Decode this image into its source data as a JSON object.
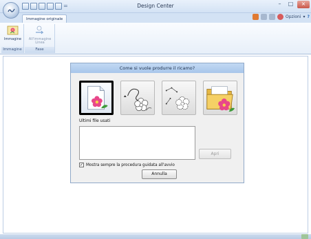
{
  "window": {
    "title": "Design Center",
    "minimize_glyph": "–",
    "maximize_glyph": "□",
    "close_glyph": "×"
  },
  "qat": {
    "separator": "="
  },
  "tabs": [
    {
      "label": "Immagine originale",
      "active": true
    }
  ],
  "tab_tools": {
    "options_label": "Opzioni",
    "dropdown_glyph": "▾",
    "help_glyph": "?"
  },
  "ribbon": {
    "groups": [
      {
        "label": "Immagine",
        "buttons": [
          {
            "label": "Immagine",
            "icon": "image-icon",
            "enabled": true
          }
        ]
      },
      {
        "label": "Fase",
        "buttons": [
          {
            "label": "All'immagine Linea",
            "icon": "arrow-next-icon",
            "enabled": false
          }
        ]
      }
    ]
  },
  "dialog": {
    "title": "Come si vuole produrre il ricamo?",
    "choices": [
      {
        "name": "new-original-image",
        "icon": "page-flower-icon",
        "selected": true
      },
      {
        "name": "line-image",
        "icon": "line-flower-icon",
        "selected": false
      },
      {
        "name": "figure-handle",
        "icon": "outline-flower-icon",
        "selected": false
      },
      {
        "name": "open-file",
        "icon": "folder-flower-icon",
        "selected": false
      }
    ],
    "recent_label": "Ultimi file usati",
    "recent_files": [],
    "open_button": "Apri",
    "open_enabled": false,
    "wizard_checkbox_label": "Mostra sempre la procedura guidata all'avvio",
    "wizard_checked": true,
    "cancel_button": "Annulla"
  },
  "colors": {
    "titlebar": "#d3e2f4",
    "dialog_title": "#a8c6ea",
    "flower_pink": "#e8488a",
    "leaf_green": "#3e9a3a"
  }
}
